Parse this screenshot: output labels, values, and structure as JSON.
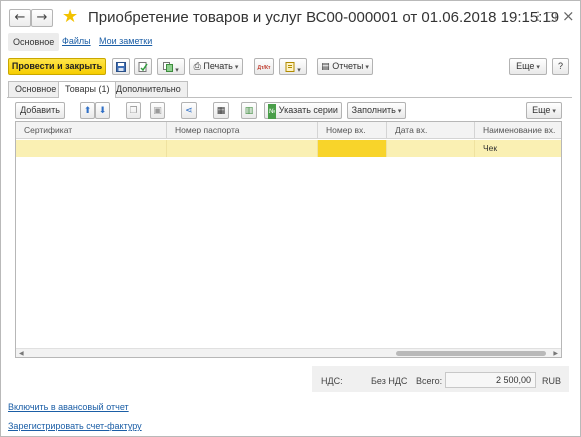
{
  "window": {
    "back_icon": "←",
    "forward_icon": "→",
    "title": "Приобретение товаров и услуг ВС00-000001 от 01.06.2018 19:15:19",
    "menu_icon": "⋮",
    "maximize_icon": "□",
    "close_icon": "×"
  },
  "sections": {
    "main": "Основное",
    "files": "Файлы",
    "notes": "Мои заметки"
  },
  "toolbar": {
    "post_close": "Провести и закрыть",
    "print": "Печать",
    "reports": "Отчеты",
    "more": "Еще",
    "help": "?",
    "dt_kt_label": "Дт/Кт"
  },
  "tabs": {
    "main": "Основное",
    "goods": "Товары (1)",
    "extra": "Дополнительно"
  },
  "table_toolbar": {
    "add": "Добавить",
    "specify_series": "Указать серии",
    "fill": "Заполнить",
    "more": "Еще"
  },
  "table": {
    "columns": [
      "Сертификат",
      "Номер паспорта",
      "Номер вх.",
      "Дата вх.",
      "Наименование вх."
    ],
    "rows": [
      [
        "",
        "",
        "",
        "",
        "Чек"
      ]
    ]
  },
  "totals": {
    "vat_label": "НДС:",
    "vat_value": "Без НДС",
    "total_label": "Всего:",
    "total_value": "2 500,00",
    "currency": "RUB"
  },
  "links": {
    "advance_report": "Включить в авансовый отчет",
    "register_invoice": "Зарегистрировать счет-фактуру"
  }
}
